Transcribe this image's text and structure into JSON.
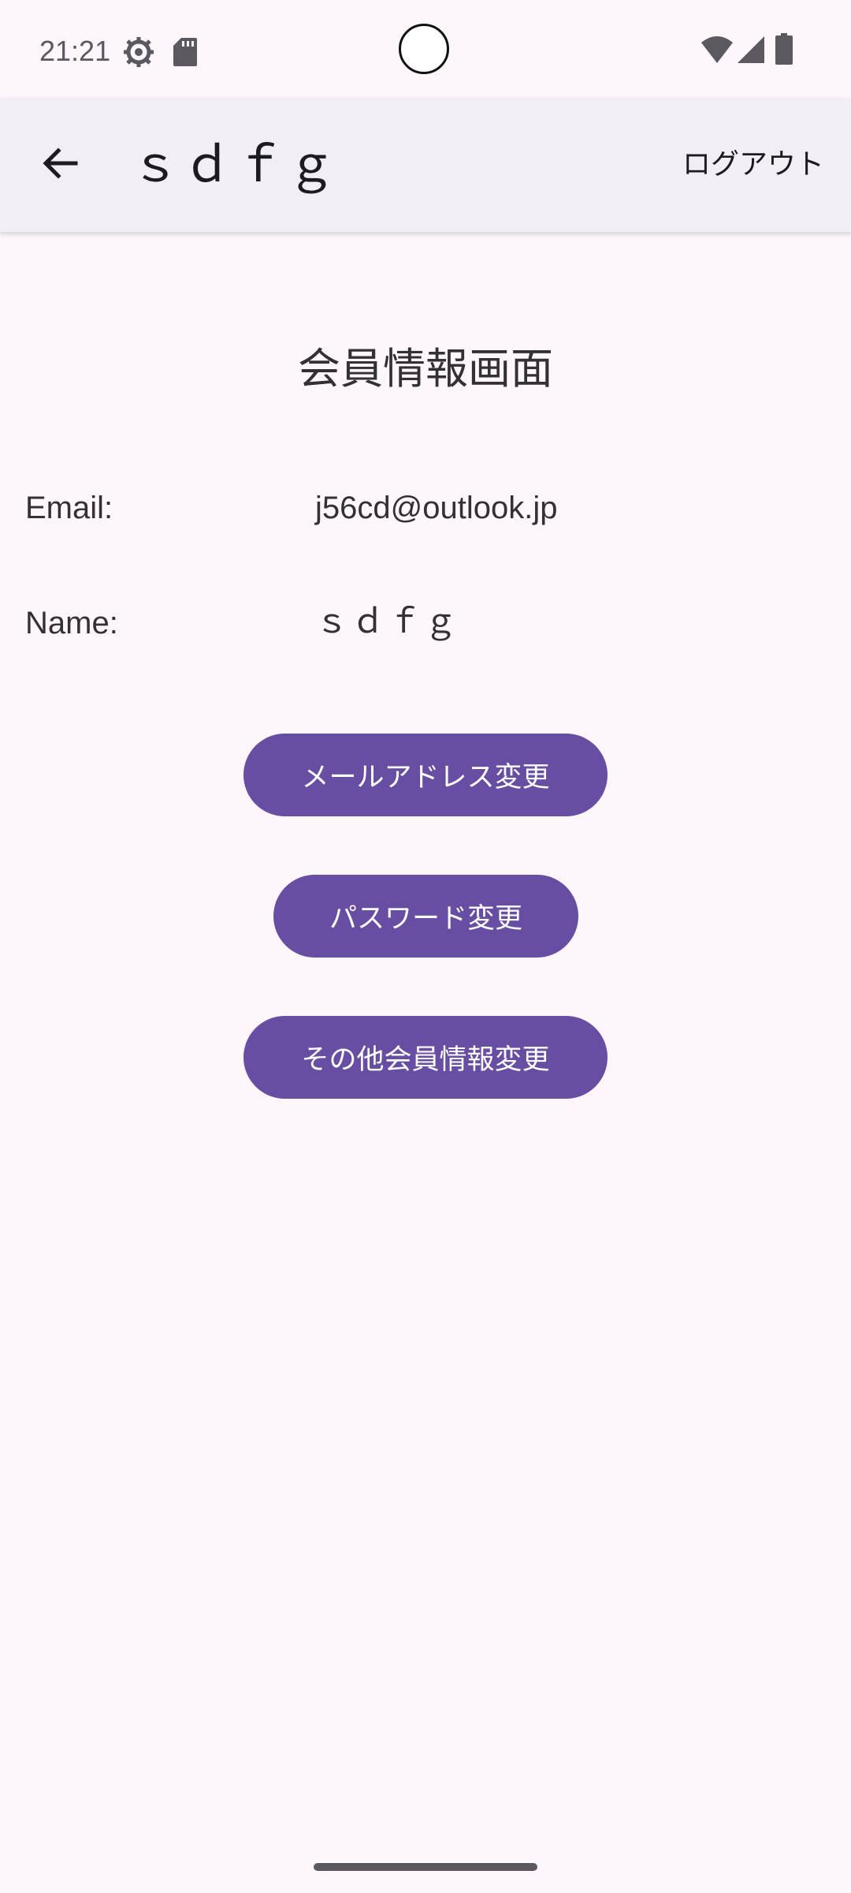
{
  "status_bar": {
    "time": "21:21",
    "icons": [
      "settings-icon",
      "sd-card-icon",
      "wifi-icon",
      "signal-icon",
      "battery-icon"
    ]
  },
  "app_bar": {
    "back_icon": "arrow-back-icon",
    "title": "ｓｄｆｇ",
    "logout_label": "ログアウト"
  },
  "main": {
    "title": "会員情報画面",
    "email_label": "Email:",
    "email_value": "j56cd@outlook.jp",
    "name_label": "Name:",
    "name_value": "ｓｄｆｇ",
    "buttons": {
      "change_email": "メールアドレス変更",
      "change_password": "パスワード変更",
      "change_other": "その他会員情報変更"
    }
  },
  "colors": {
    "background": "#fdf7fc",
    "app_bar": "#f2eef6",
    "accent": "#674ea2"
  }
}
